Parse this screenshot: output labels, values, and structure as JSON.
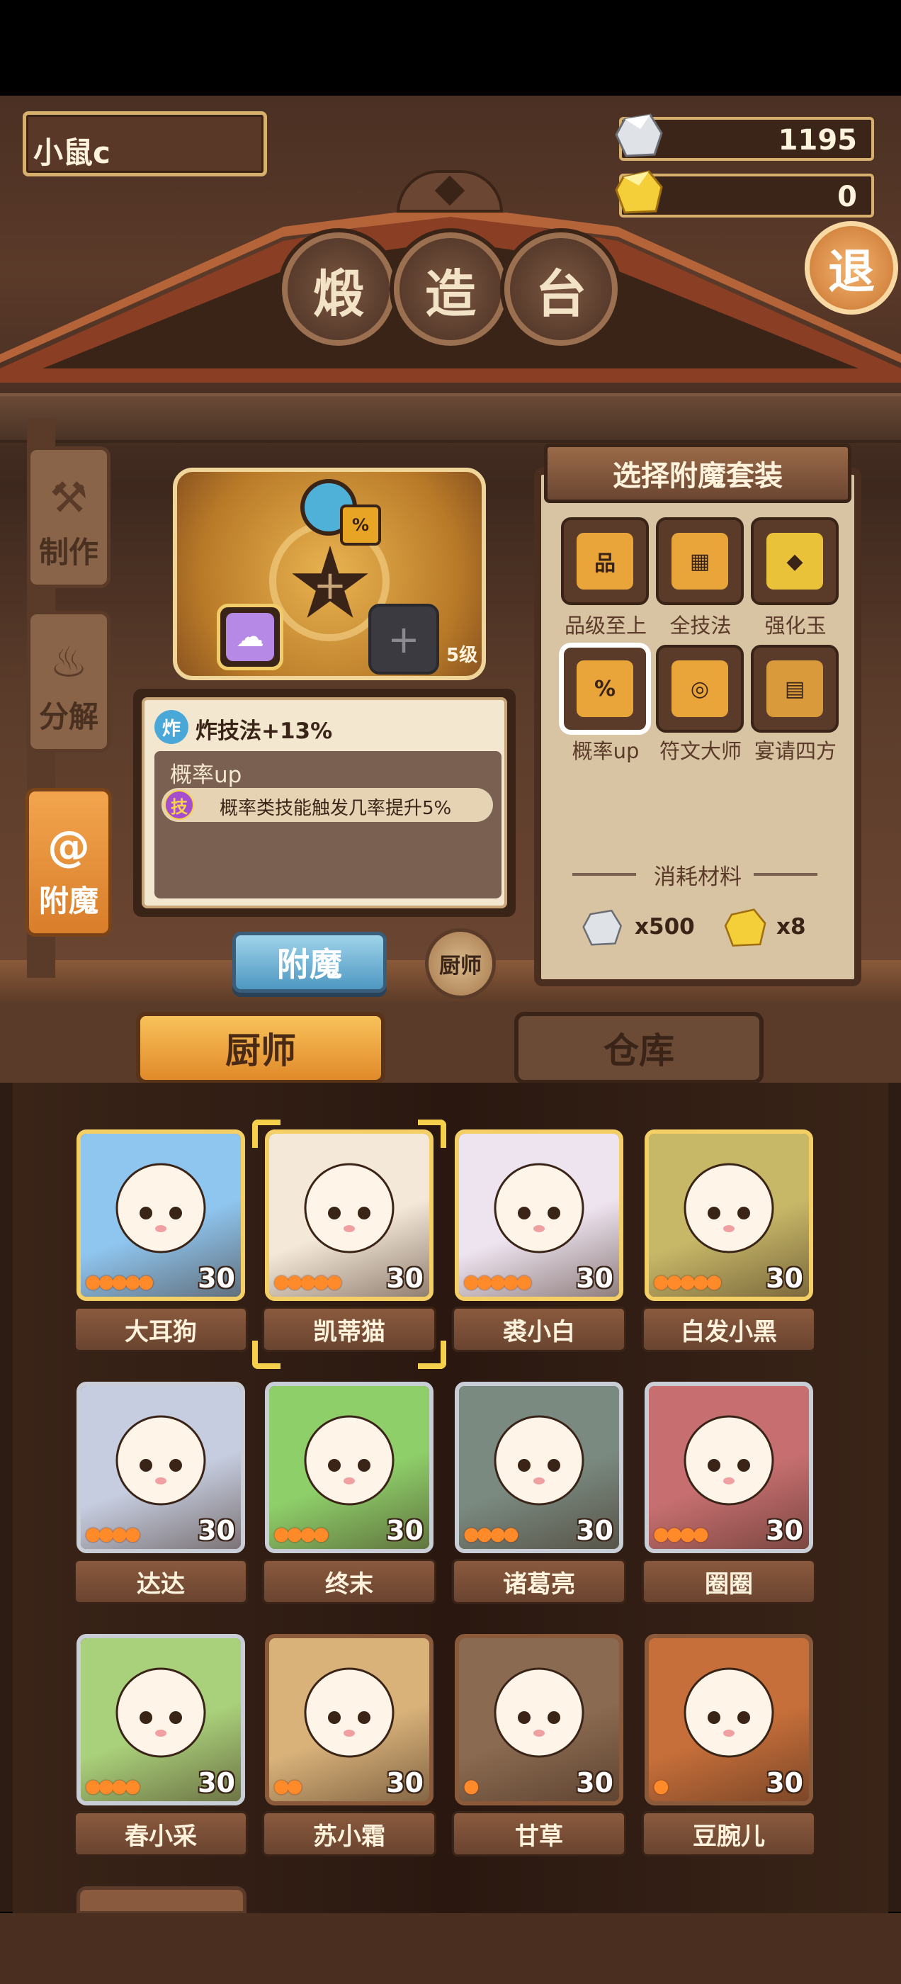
{
  "player": {
    "name": "小鼠c"
  },
  "currency": {
    "silver": "1195",
    "gold": "0"
  },
  "title": [
    "煅",
    "造",
    "台"
  ],
  "exit_label": "退",
  "side_tabs": [
    {
      "label": "制作",
      "icon": "hammer-icon",
      "active": false
    },
    {
      "label": "分解",
      "icon": "fire-icon",
      "active": false
    },
    {
      "label": "附魔",
      "icon": "swirl-icon",
      "active": true
    }
  ],
  "altar": {
    "level": "5级",
    "top_badge": "%",
    "center_symbol": "+",
    "right_symbol": "+"
  },
  "info": {
    "badge": "炸",
    "header": "炸技法+13%",
    "card_title": "概率up",
    "line_badge": "技",
    "line_text": "概率类技能触发几率提升5%"
  },
  "enchant_button": "附魔",
  "chef_round_button": "厨师",
  "set_panel": {
    "title": "选择附魔套装",
    "items": [
      {
        "label": "品级至上",
        "glyph": "品",
        "color": "#e9a43a",
        "selected": false
      },
      {
        "label": "全技法",
        "glyph": "▦",
        "color": "#e9a43a",
        "selected": false
      },
      {
        "label": "强化玉",
        "glyph": "◆",
        "color": "#e9c23a",
        "selected": false
      },
      {
        "label": "概率up",
        "glyph": "%",
        "color": "#e9a43a",
        "selected": true
      },
      {
        "label": "符文大师",
        "glyph": "◎",
        "color": "#e9a43a",
        "selected": false
      },
      {
        "label": "宴请四方",
        "glyph": "▤",
        "color": "#d89a3a",
        "selected": false
      }
    ],
    "consume_label": "消耗材料",
    "cost_silver": "x500",
    "cost_gold": "x8"
  },
  "bottom_tabs": {
    "chef": "厨师",
    "store": "仓库"
  },
  "chefs": [
    {
      "name": "大耳狗",
      "level": "30",
      "stars": 5,
      "frame": "gold",
      "color": "#8fc6f0"
    },
    {
      "name": "凯蒂猫",
      "level": "30",
      "stars": 5,
      "frame": "gold",
      "color": "#f4e8d8",
      "selected": true
    },
    {
      "name": "裘小白",
      "level": "30",
      "stars": 5,
      "frame": "gold",
      "color": "#eee4f0"
    },
    {
      "name": "白发小黑",
      "level": "30",
      "stars": 5,
      "frame": "gold",
      "color": "#c7b868"
    },
    {
      "name": "达达",
      "level": "30",
      "stars": 4,
      "frame": "silver",
      "color": "#c6cde0"
    },
    {
      "name": "终末",
      "level": "30",
      "stars": 4,
      "frame": "silver",
      "color": "#8ecf6a"
    },
    {
      "name": "诸葛亮",
      "level": "30",
      "stars": 4,
      "frame": "silver",
      "color": "#7a8a80"
    },
    {
      "name": "圈圈",
      "level": "30",
      "stars": 4,
      "frame": "silver",
      "color": "#c76f70"
    },
    {
      "name": "春小采",
      "level": "30",
      "stars": 4,
      "frame": "silver",
      "color": "#a9d07a"
    },
    {
      "name": "苏小霜",
      "level": "30",
      "stars": 2,
      "frame": "bronze",
      "color": "#d9b27a"
    },
    {
      "name": "甘草",
      "level": "30",
      "stars": 1,
      "frame": "bronze",
      "color": "#8a6a50"
    },
    {
      "name": "豆腕儿",
      "level": "30",
      "stars": 1,
      "frame": "bronze",
      "color": "#c76f3a"
    }
  ]
}
